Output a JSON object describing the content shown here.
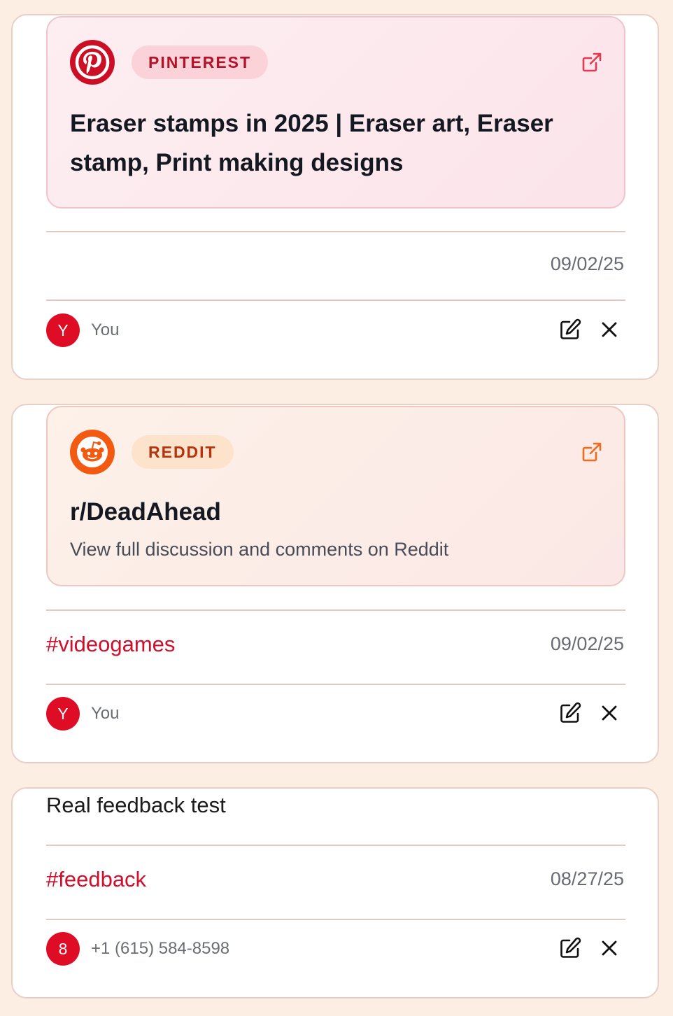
{
  "cards": [
    {
      "platform_badge": "PINTEREST",
      "platform_logo": "pinterest-logo-icon",
      "title": "Eraser stamps in 2025 | Eraser art, Eraser stamp, Print making designs",
      "date": "09/02/25",
      "author_initial": "Y",
      "author_name": "You"
    },
    {
      "platform_badge": "REDDIT",
      "platform_logo": "reddit-logo-icon",
      "title": "r/DeadAhead",
      "subtitle": "View full discussion and comments on Reddit",
      "tag": "#videogames",
      "date": "09/02/25",
      "author_initial": "Y",
      "author_name": "You"
    },
    {
      "body": "Real feedback test",
      "tag": "#feedback",
      "date": "08/27/25",
      "author_initial": "8",
      "author_name": "+1 (615) 584-8598"
    }
  ],
  "colors": {
    "background": "#fdeee4",
    "pinterest": "#cc0f24",
    "reddit": "#f25a11",
    "tag": "#d10f2c",
    "avatar": "#df0c25"
  }
}
